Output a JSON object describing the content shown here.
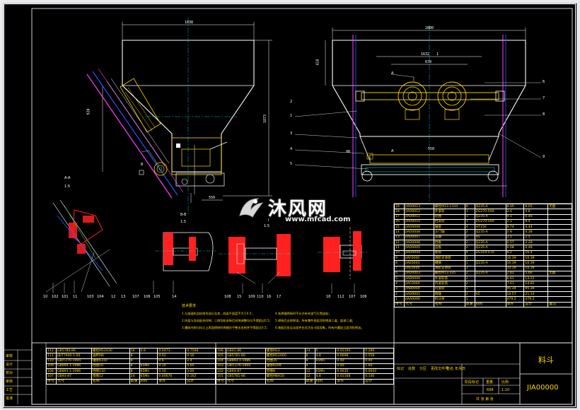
{
  "dimensions": {
    "top_width_left": "1038",
    "left_height_1": "920",
    "left_height_2": "1873",
    "top_width_right": "2800",
    "right_height": "418",
    "right_sub_1": "1632",
    "right_sub_2": "1",
    "right_sub_3": "678",
    "right_sub_4": "550",
    "left_bottom_dim": "550",
    "right_small_dim": "98"
  },
  "view_labels": {
    "section_aa": "A-A",
    "section_aa_scale": "1:5",
    "section_bb": "B-B",
    "section_bb_scale": "1:5",
    "view_i": "I",
    "view_i_scale": "1:5",
    "arrow_a_1": "A",
    "arrow_a_2": "A",
    "arrow_b": "B"
  },
  "balloons_right": [
    "1",
    "2",
    "3",
    "4",
    "5",
    "6",
    "7",
    "8",
    "9"
  ],
  "balloons_bottom_left": [
    "10",
    "102",
    "101",
    "11",
    "103",
    "104",
    "12",
    "13",
    "107",
    "106",
    "105",
    "14"
  ],
  "balloons_bottom_mid": [
    "108",
    "15",
    "109",
    "110",
    "16",
    "17"
  ],
  "balloons_bottom_right": [
    "18",
    "112",
    "107",
    "106"
  ],
  "notes": {
    "title": "技术要求",
    "lines": [
      "1.与减速机齿轮啮合部分及其...机架平面度不大于0.5；",
      "2.托架与导轨配合间隙；二侧导轨安装后间隙调整均匀不得超过0.5；",
      "3.槽体内侧与料斗上表面焊接时焊缝应平整无毛刺并不得超过0.5；",
      "4.各焊缝焊接时不允许有夹渣气孔等缺陷；",
      "5.焊接后去除焊渣，所有零件表面涂防锈漆二道，面漆二道；",
      "6.装配后各运动部件应灵活无卡阻现象，所有外露加工面涂防锈油。"
    ]
  },
  "parts_right": [
    [
      "19",
      "JIAO0013",
      "螺栓M13-1334",
      "8",
      "Q235-A",
      "8.05",
      "8.05",
      "无图"
    ],
    [
      "18",
      "JIAO0012",
      "外滚轮",
      "1",
      "ZG270-500",
      "2.4",
      "4.8",
      ""
    ],
    [
      "17",
      "JIAO0011",
      "轮圈",
      "1",
      "Q235-A",
      "0.1",
      "0.46",
      ""
    ],
    [
      "16",
      "JIAO0010",
      "挡滚轮",
      "1",
      "ZG270-500",
      "2.1",
      "8.4",
      ""
    ],
    [
      "15",
      "JIAO0009",
      "轴套",
      "4",
      "HT150",
      "8.74",
      "4.44",
      ""
    ],
    [
      "14",
      "JIAO0008",
      "斗门轴",
      "2",
      "Q235-A",
      "2.9",
      "4.38",
      ""
    ],
    [
      "13",
      "JIAO0007",
      "滚轴",
      "2",
      "45",
      "2.5",
      "2.5",
      ""
    ],
    [
      "12",
      "JIAO0006",
      "挡板",
      "2",
      "Q235-A",
      "0.57",
      "2.28",
      ""
    ],
    [
      "11",
      "JIAO0005",
      "压板",
      "2",
      "Q235-A",
      "0.08",
      "0.48",
      ""
    ],
    [
      "10",
      "JIAO0004",
      "套筒",
      "4",
      "ZG310-570",
      "8.2",
      "16.4",
      ""
    ],
    [
      "9",
      "JIAF0000",
      "滑轮支承装",
      "1",
      "",
      "10.39",
      "10.39",
      ""
    ],
    [
      "8",
      "JIAE0003",
      "槽钢",
      "1",
      "Q235-A",
      "10.39",
      "10.39",
      ""
    ],
    [
      "7",
      "JIAE0000",
      "滑轮支承装",
      "1",
      "",
      "10.39",
      "10.39",
      ""
    ],
    [
      "6",
      "JIAO0003",
      "螺栓M13-335",
      "2",
      "Q235-A",
      "2.83",
      "5.66",
      "无图"
    ],
    [
      "5",
      "JIAD0000",
      "外滚轮装",
      "2",
      "",
      "6.61",
      "13.22",
      ""
    ],
    [
      "4",
      "JIAC0000",
      "内滚轮装",
      "2",
      "",
      "7.41",
      "14.82",
      ""
    ],
    [
      "3",
      "JIAB0000",
      "内滚轮",
      "1",
      "",
      "95.34",
      "95.34",
      ""
    ],
    [
      "2",
      "JIAO0001",
      "销轴",
      "2",
      "45",
      "10.57",
      "21.14",
      ""
    ],
    [
      "1",
      "JIAA0000",
      "料斗体",
      "1",
      "",
      "479.2",
      "479.2",
      ""
    ]
  ],
  "parts_right_header": [
    "序号",
    "代号",
    "名称",
    "数量",
    "材料",
    "单件",
    "总计",
    "备注"
  ],
  "parts_bottom_left": [
    [
      "112",
      "GB5780-86",
      "螺栓M12X30",
      "16",
      "4.8",
      "0.0473",
      "0.7568"
    ],
    [
      "111",
      "JB/T7940.1-95",
      "油杯M6",
      "8",
      "",
      "0.02",
      "0.16"
    ],
    [
      "110",
      "GB/T276-1994",
      "轴承6310",
      "8",
      "",
      "0.6",
      "2.4"
    ],
    [
      "109",
      "GB894.1-1986",
      "挡圈50",
      "8",
      "65Mn",
      "0.10",
      "0.60"
    ],
    [
      "108",
      "GB893.1-1986",
      "挡圈110",
      "8",
      "65Mn",
      "0.10",
      "3.00"
    ],
    [
      "107",
      "GB93-87",
      "垫圈12",
      "24",
      "65Mn",
      "0.00676",
      "0.162"
    ]
  ],
  "parts_bottom_mid": [
    [
      "106",
      "GB41-86",
      "螺母M12",
      "24",
      "5",
      "0.01193",
      "0.286"
    ],
    [
      "105",
      "GB5781-86",
      "螺栓M12X60",
      "8",
      "4.8",
      "0.0698",
      "0.558"
    ],
    [
      "104",
      "GB893.1-1986",
      "挡圈35",
      "8",
      "65Mn",
      "0.40",
      "0.40"
    ],
    [
      "103",
      "GB/T276-1994",
      "轴承6209",
      "4",
      "",
      "0.40",
      "1.60"
    ],
    [
      "102",
      "GB93-87",
      "垫圈8",
      "12",
      "65Mn",
      "0.0035",
      "0.0042"
    ],
    [
      "101",
      "GB5781-86",
      "螺栓M8X16",
      "12",
      "4.8",
      "0.01168",
      "0.140"
    ]
  ],
  "parts_bottom_header_left": [
    "序号",
    "代号",
    "名称",
    "数量",
    "材料",
    "单件",
    "总计"
  ],
  "parts_bottom_header_mid": [
    "序号",
    "代号",
    "名称",
    "数量",
    "材料",
    "单件",
    "总计"
  ],
  "left_strip_labels": [
    "审核",
    "设计",
    "校对",
    "审核",
    "工艺",
    "批准"
  ],
  "title_block": {
    "part_name": "料斗",
    "drawing_code": "JIA00000",
    "mass_label": "阶段标记",
    "weight_label": "重量",
    "scale_label": "比例",
    "weight_value": "698",
    "scale_value": "1:10",
    "sheet_label": "共 张 第 张",
    "signature_row": [
      "标记",
      "处数",
      "分区",
      "更改文件号",
      "签名",
      "年月日"
    ]
  },
  "watermark": {
    "brand": "沐风网",
    "url": "www.mfcad.com"
  },
  "colors": {
    "background": "#000000",
    "outline": "#ffffff",
    "yellow": "#ffd800",
    "cyan": "#00e5e5",
    "red": "#ff2020",
    "blue": "#3050ff",
    "magenta": "#ff40ff",
    "green": "#40ff40"
  }
}
